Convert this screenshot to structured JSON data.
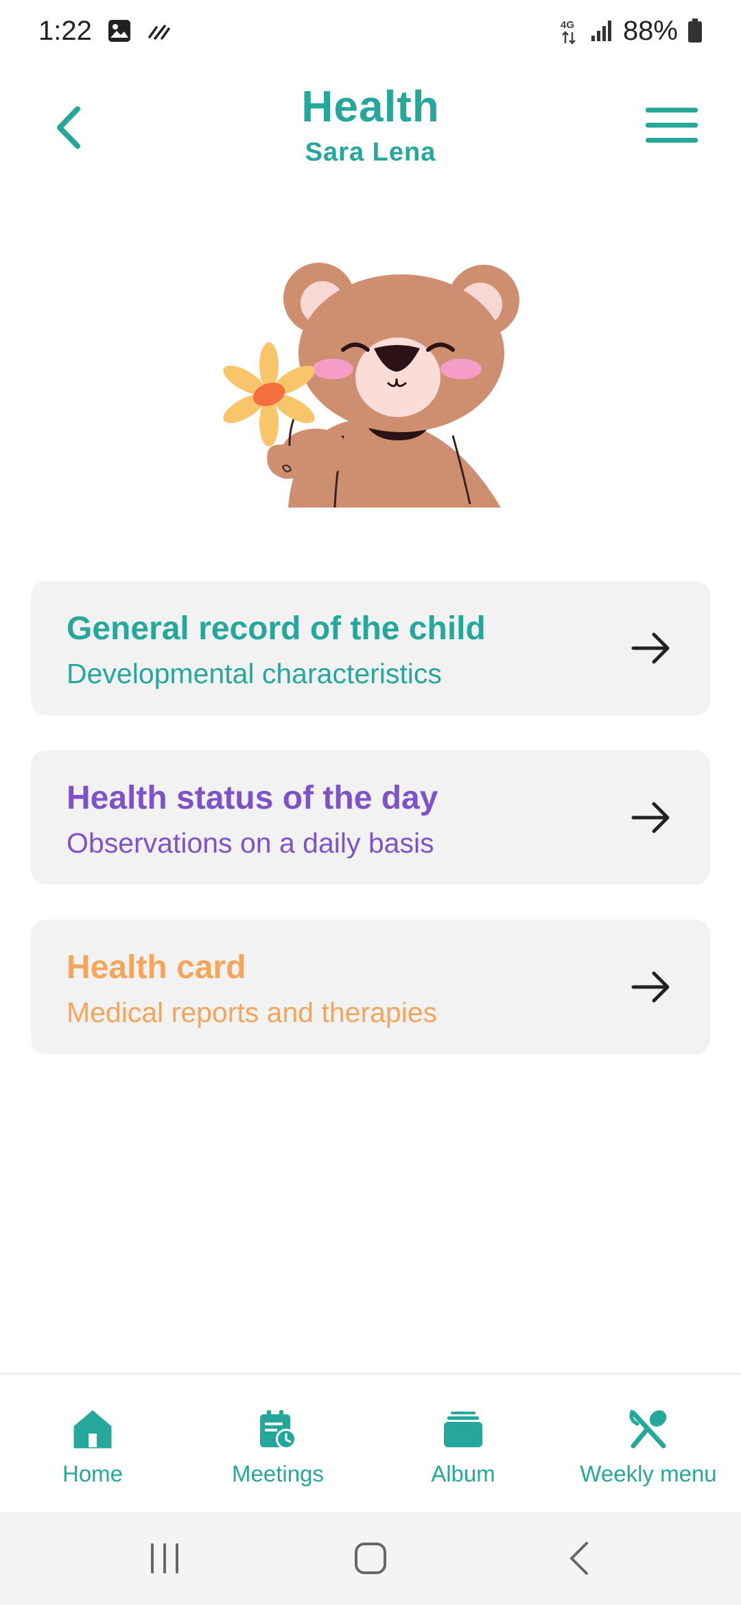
{
  "status_bar": {
    "time": "1:22",
    "network": "4G",
    "battery": "88%",
    "icons": [
      "image-icon",
      "sync-icon",
      "network-4g-icon",
      "signal-icon",
      "battery-icon"
    ]
  },
  "header": {
    "title": "Health",
    "subtitle": "Sara Lena",
    "back_icon": "chevron-left-icon",
    "menu_icon": "hamburger-menu-icon"
  },
  "illustration": "bear-with-flower",
  "cards": [
    {
      "title": "General record of the child",
      "subtitle": "Developmental characteristics",
      "color": "#25a89b",
      "icon": "arrow-right-icon"
    },
    {
      "title": "Health status of the day",
      "subtitle": "Observations on a daily basis",
      "color": "#7e52c8",
      "icon": "arrow-right-icon"
    },
    {
      "title": "Health card",
      "subtitle": "Medical reports and therapies",
      "color": "#f5a55a",
      "icon": "arrow-right-icon"
    }
  ],
  "bottom_nav": [
    {
      "label": "Home",
      "icon": "home-icon"
    },
    {
      "label": "Meetings",
      "icon": "calendar-clock-icon"
    },
    {
      "label": "Album",
      "icon": "album-icon"
    },
    {
      "label": "Weekly menu",
      "icon": "cutlery-icon"
    }
  ],
  "system_nav": [
    "recents-icon",
    "home-circle-icon",
    "back-icon"
  ],
  "colors": {
    "accent": "#25a89b",
    "card_background": "#f2f2f2"
  }
}
